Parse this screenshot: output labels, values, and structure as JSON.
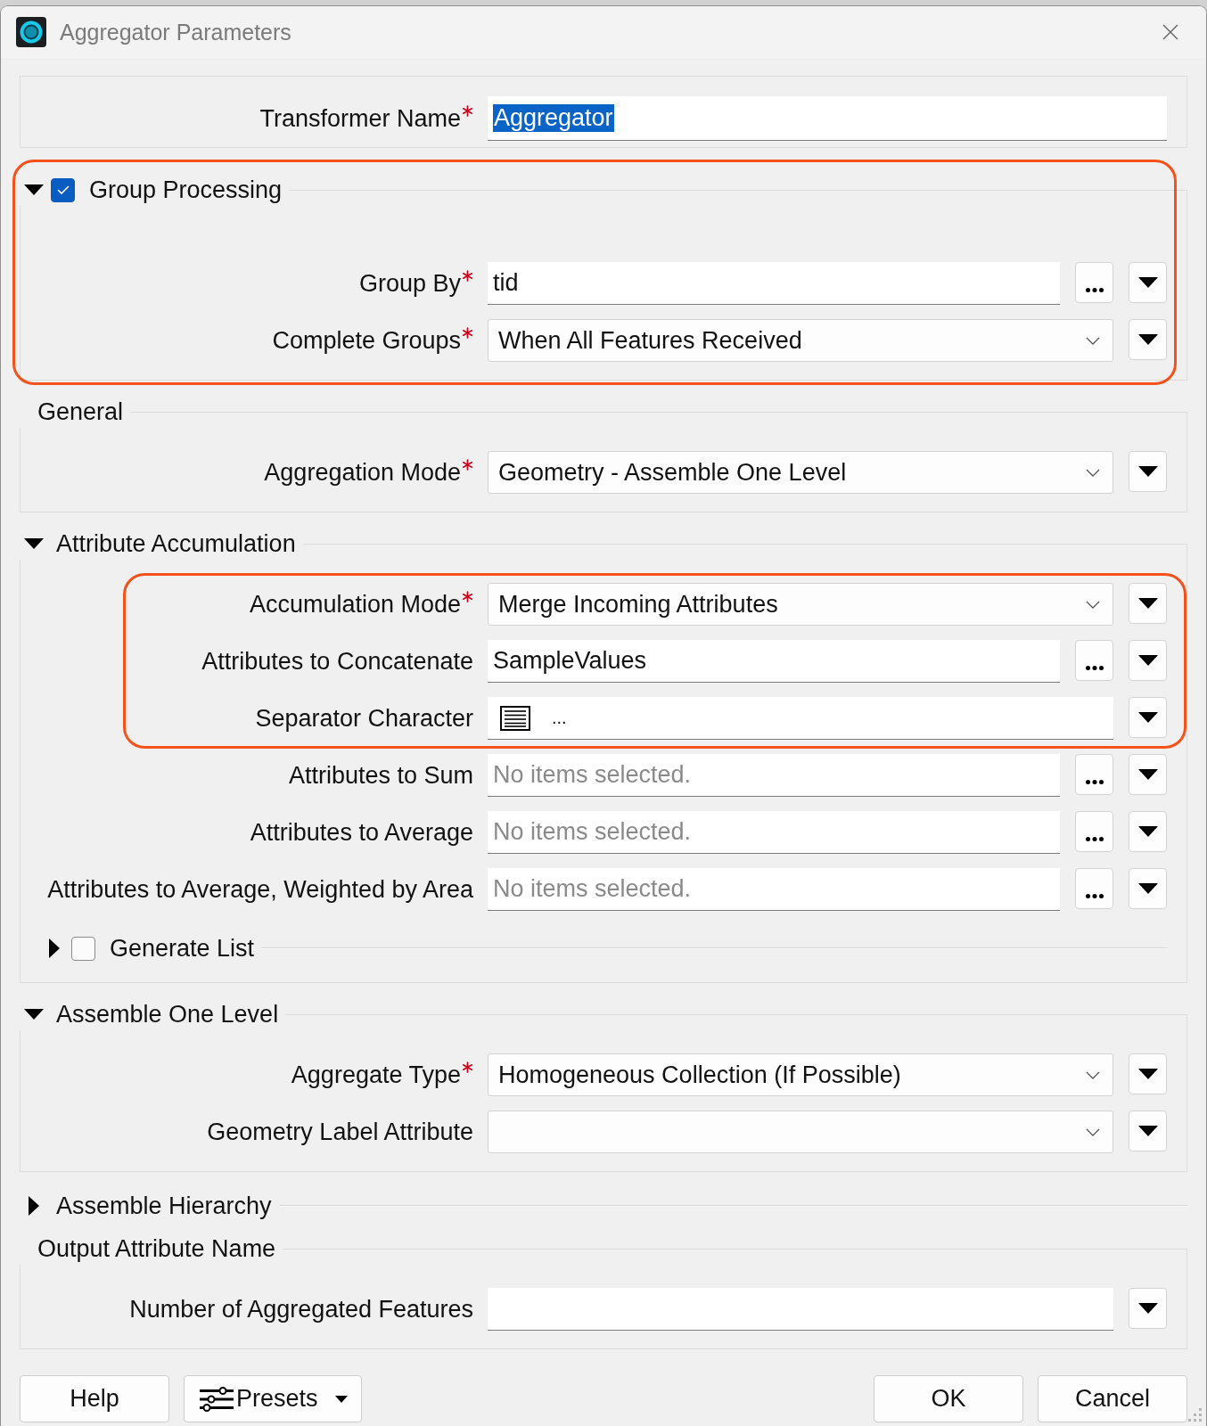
{
  "window": {
    "title": "Aggregator Parameters"
  },
  "name_field": {
    "label": "Transformer Name",
    "required": true,
    "value": "Aggregator",
    "text_selected": true
  },
  "sections": [
    {
      "kind": "checkable",
      "title": "Group Processing",
      "expanded": true,
      "checked": true,
      "highlighted": true,
      "rows": [
        {
          "kind": "list",
          "label": "Group By",
          "required": true,
          "value": "tid",
          "highlighted": false
        },
        {
          "kind": "combo",
          "label": "Complete Groups",
          "required": true,
          "value": "When All Features Received",
          "highlighted": false
        }
      ]
    },
    {
      "kind": "plain",
      "title": "General",
      "expanded": true,
      "highlighted": false,
      "rows": [
        {
          "kind": "combo",
          "label": "Aggregation Mode",
          "required": true,
          "value": "Geometry - Assemble One Level",
          "highlighted": false
        }
      ]
    },
    {
      "kind": "collapsible",
      "title": "Attribute Accumulation",
      "expanded": true,
      "highlighted": false,
      "rows": [
        {
          "kind": "combo",
          "label": "Accumulation Mode",
          "required": true,
          "value": "Merge Incoming Attributes",
          "highlighted": true
        },
        {
          "kind": "list",
          "label": "Attributes to Concatenate",
          "required": false,
          "value": "SampleValues",
          "highlighted": true
        },
        {
          "kind": "separator",
          "label": "Separator Character",
          "required": false,
          "value": "...",
          "highlighted": true
        },
        {
          "kind": "list",
          "label": "Attributes to Sum",
          "required": false,
          "placeholder": "No items selected.",
          "highlighted": false
        },
        {
          "kind": "list",
          "label": "Attributes to Average",
          "required": false,
          "placeholder": "No items selected.",
          "highlighted": false
        },
        {
          "kind": "list",
          "label": "Attributes to Average, Weighted by Area",
          "required": false,
          "placeholder": "No items selected.",
          "highlighted": false
        }
      ],
      "subsections": [
        {
          "kind": "checkable",
          "title": "Generate List",
          "expanded": false,
          "checked": false,
          "highlighted": false
        }
      ]
    },
    {
      "kind": "collapsible",
      "title": "Assemble One Level",
      "expanded": true,
      "highlighted": false,
      "rows": [
        {
          "kind": "combo",
          "label": "Aggregate Type",
          "required": true,
          "value": "Homogeneous Collection (If Possible)",
          "highlighted": false
        },
        {
          "kind": "combo",
          "label": "Geometry Label Attribute",
          "required": false,
          "highlighted": false
        }
      ]
    },
    {
      "kind": "collapsible",
      "title": "Assemble Hierarchy",
      "expanded": false,
      "highlighted": false
    },
    {
      "kind": "plain",
      "title": "Output Attribute Name",
      "expanded": true,
      "highlighted": false,
      "rows": [
        {
          "kind": "text",
          "label": "Number of Aggregated Features",
          "required": false,
          "highlighted": false
        }
      ]
    }
  ],
  "footer": {
    "left_buttons": [
      {
        "kind": "plain",
        "label": "Help"
      },
      {
        "kind": "presets",
        "label": "Presets"
      }
    ],
    "right_buttons": [
      {
        "kind": "plain",
        "label": "OK"
      },
      {
        "kind": "plain",
        "label": "Cancel"
      }
    ]
  }
}
